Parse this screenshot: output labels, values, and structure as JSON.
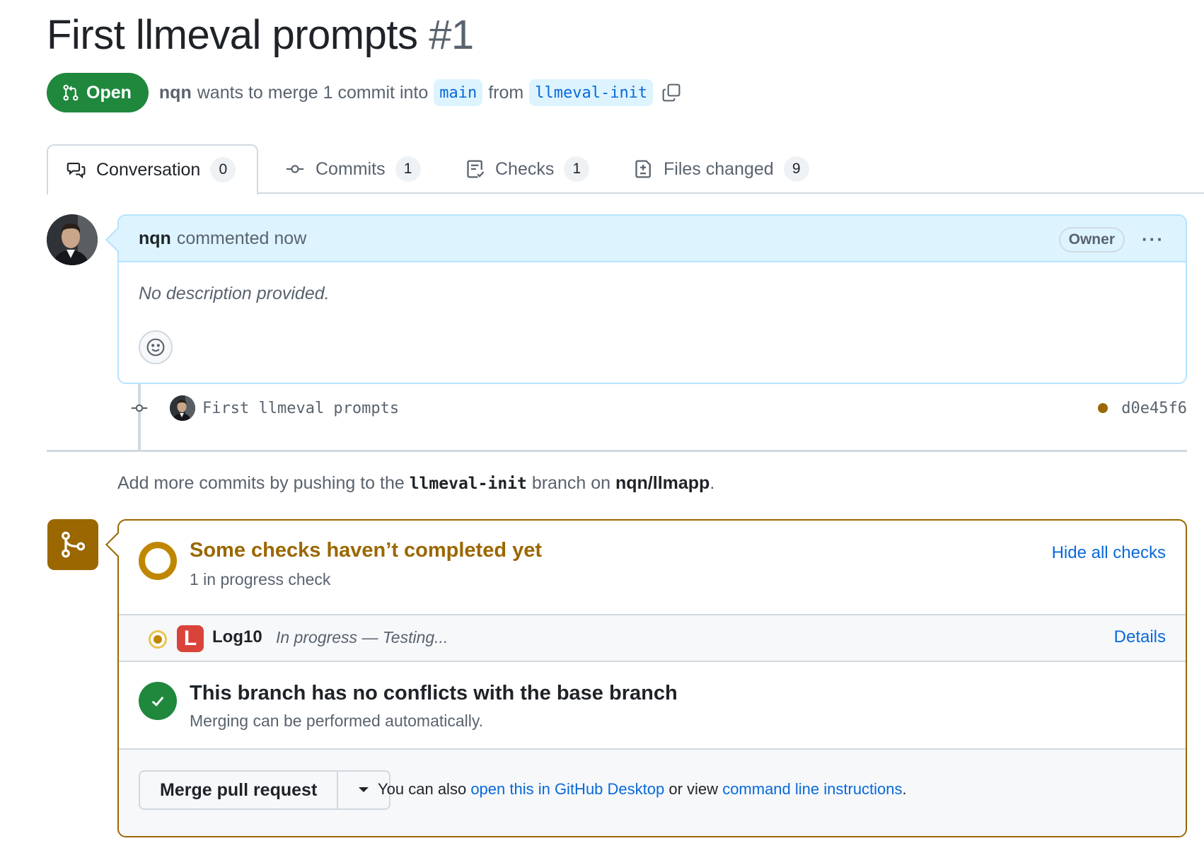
{
  "pr": {
    "title": "First llmeval prompts",
    "number": "#1",
    "state": "Open",
    "author": "nqn",
    "merge_text": "wants to merge 1 commit into",
    "base_branch": "main",
    "from_text": "from",
    "head_branch": "llmeval-init"
  },
  "tabs": [
    {
      "label": "Conversation",
      "count": "0",
      "icon": "comment-discussion-icon"
    },
    {
      "label": "Commits",
      "count": "1",
      "icon": "commit-icon"
    },
    {
      "label": "Checks",
      "count": "1",
      "icon": "checklist-icon"
    },
    {
      "label": "Files changed",
      "count": "9",
      "icon": "file-diff-icon"
    }
  ],
  "comment": {
    "author": "nqn",
    "action": "commented now",
    "role": "Owner",
    "menu": "···",
    "body": "No description provided."
  },
  "commit": {
    "message": "First llmeval prompts",
    "sha": "d0e45f6",
    "status_color": "#9a6700"
  },
  "push_hint": {
    "prefix": "Add more commits by pushing to the",
    "branch": "llmeval-init",
    "middle": "branch on",
    "repo": "nqn/llmapp",
    "suffix": "."
  },
  "merge": {
    "checks_title": "Some checks haven’t completed yet",
    "checks_sub": "1 in progress check",
    "hide_checks": "Hide all checks",
    "check_app_letter": "L",
    "check_name": "Log10",
    "check_status": "In progress — Testing...",
    "details": "Details",
    "conflict_title": "This branch has no conflicts with the base branch",
    "conflict_sub": "Merging can be performed automatically.",
    "merge_button": "Merge pull request",
    "hint_prefix": "You can also",
    "hint_link1": "open this in GitHub Desktop",
    "hint_middle": "or view",
    "hint_link2": "command line instructions",
    "hint_suffix": "."
  },
  "colors": {
    "open_green": "#1f883d",
    "pending": "#9a6700",
    "link": "#0969da"
  }
}
